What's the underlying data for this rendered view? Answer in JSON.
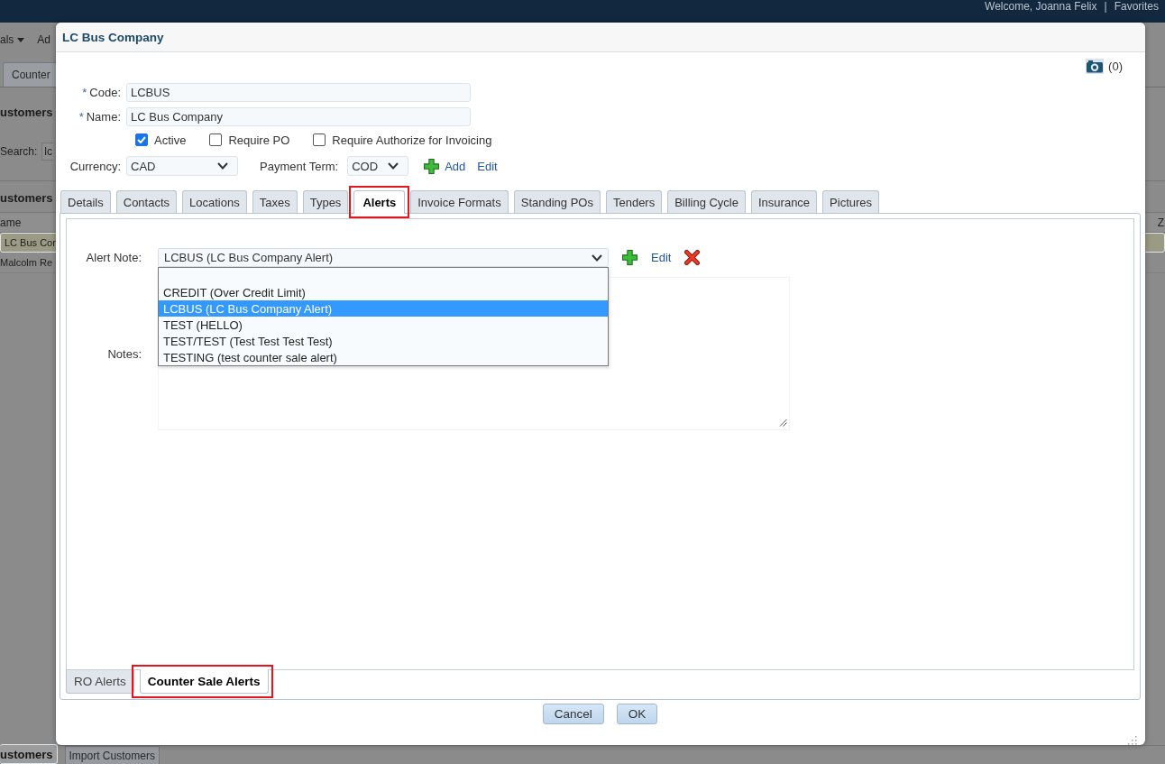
{
  "top_bar": {
    "welcome": "Welcome, Joanna Felix",
    "separator": "|",
    "link": "Favorites"
  },
  "background": {
    "menu": [
      {
        "label": "als",
        "dropdown": true
      },
      {
        "label": "Ad",
        "dropdown": false
      }
    ],
    "tabs": [
      {
        "label": "Counter",
        "selected": false
      }
    ],
    "section_title": "ustomers",
    "search": {
      "label": "Search:",
      "value": "lc"
    },
    "list_title": "ustomers",
    "columns": [
      "ame",
      "Z"
    ],
    "rows": [
      {
        "name": "LC Bus Cor",
        "selected": true
      },
      {
        "name": "Malcolm Re",
        "selected": false
      }
    ],
    "bottom_tabs": [
      {
        "label": "ustomers",
        "selected": true
      },
      {
        "label": "Import Customers",
        "selected": false
      }
    ]
  },
  "dialog": {
    "title": "LC Bus Company",
    "attachments": "(0)",
    "fields": [
      {
        "mark": "*",
        "label": "Code:",
        "value": "LCBUS"
      },
      {
        "mark": "*",
        "label": "Name:",
        "value": "LC Bus Company"
      }
    ],
    "checkboxes": [
      {
        "label": "Active",
        "checked": true
      },
      {
        "label": "Require PO",
        "checked": false
      },
      {
        "label": "Require Authorize for Invoicing",
        "checked": false
      }
    ],
    "selects": [
      {
        "label": "Currency:",
        "value": "CAD"
      },
      {
        "label": "Payment Term:",
        "value": "COD"
      }
    ],
    "links": [
      {
        "label": "Add",
        "kind": "add"
      },
      {
        "label": "Edit",
        "kind": "edit"
      }
    ],
    "tabs": [
      {
        "label": "Details",
        "selected": false,
        "highlighted": false
      },
      {
        "label": "Contacts",
        "selected": false,
        "highlighted": false
      },
      {
        "label": "Locations",
        "selected": false,
        "highlighted": false
      },
      {
        "label": "Taxes",
        "selected": false,
        "highlighted": false
      },
      {
        "label": "Types",
        "selected": false,
        "highlighted": false
      },
      {
        "label": "Alerts",
        "selected": true,
        "highlighted": true
      },
      {
        "label": "Invoice Formats",
        "selected": false,
        "highlighted": false
      },
      {
        "label": "Standing POs",
        "selected": false,
        "highlighted": false
      },
      {
        "label": "Tenders",
        "selected": false,
        "highlighted": false
      },
      {
        "label": "Billing Cycle",
        "selected": false,
        "highlighted": false
      },
      {
        "label": "Insurance",
        "selected": false,
        "highlighted": false
      },
      {
        "label": "Pictures",
        "selected": false,
        "highlighted": false
      }
    ],
    "alert_note": {
      "label": "Alert Note:",
      "value": "LCBUS (LC Bus Company Alert)",
      "expanded": true,
      "blank_option": true,
      "options": [
        {
          "label": "CREDIT (Over Credit Limit)",
          "selected": false
        },
        {
          "label": "LCBUS (LC Bus Company Alert)",
          "selected": true
        },
        {
          "label": "TEST (HELLO)",
          "selected": false
        },
        {
          "label": "TEST/TEST (Test Test Test Test)",
          "selected": false
        },
        {
          "label": "TESTING (test counter sale alert)",
          "selected": false
        }
      ],
      "actions": [
        {
          "kind": "add"
        },
        {
          "kind": "edit",
          "label": "Edit"
        },
        {
          "kind": "delete"
        }
      ]
    },
    "notes": {
      "label": "Notes:"
    },
    "subtabs": [
      {
        "label": "RO Alerts",
        "selected": false,
        "highlighted": false
      },
      {
        "label": "Counter Sale Alerts",
        "selected": true,
        "highlighted": true
      }
    ],
    "buttons": [
      "Cancel",
      "OK"
    ]
  }
}
